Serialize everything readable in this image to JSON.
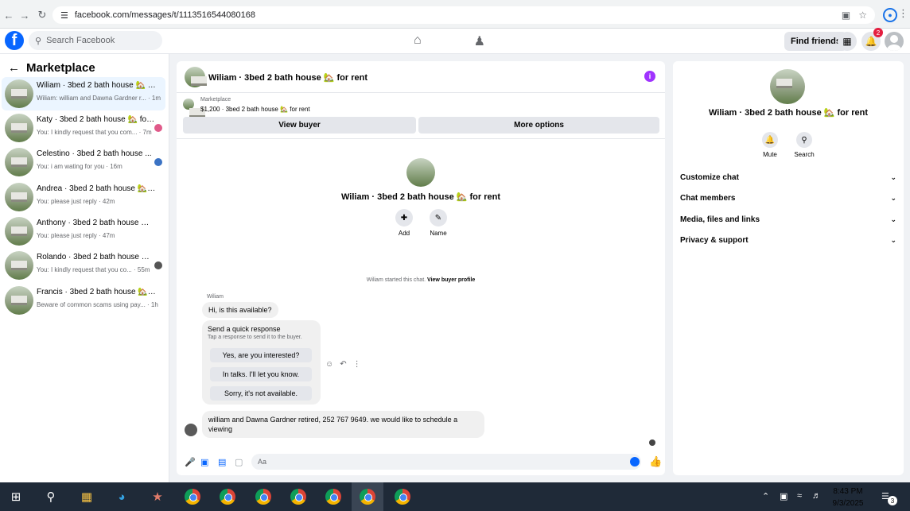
{
  "browser": {
    "url": "facebook.com/messages/t/1113516544080168"
  },
  "topbar": {
    "search_placeholder": "Search Facebook",
    "find_friends": "Find friends",
    "notif_count": "2"
  },
  "sidebar": {
    "title": "Marketplace",
    "conversations": [
      {
        "name": "Wiliam · 3bed 2 bath house 🏡 for...",
        "preview": "Wiliam: william and Dawna Gardner r... · 1m"
      },
      {
        "name": "Katy · 3bed 2 bath house 🏡 for ...",
        "preview": "You: I kindly request that you com... · 7m"
      },
      {
        "name": "Celestino · 3bed 2 bath house ...",
        "preview": "You: i am wating for you · 16m"
      },
      {
        "name": "Andrea · 3bed 2 bath house 🏡 for...",
        "preview": "You: please just reply · 42m"
      },
      {
        "name": "Anthony · 3bed 2 bath house 🏡 f...",
        "preview": "You: please just reply · 47m"
      },
      {
        "name": "Rolando · 3bed 2 bath house 🏡 ...",
        "preview": "You: I kindly request that you co... · 55m"
      },
      {
        "name": "Francis · 3bed 2 bath house 🏡 for...",
        "preview": "Beware of common scams using pay... · 1h"
      }
    ]
  },
  "chat": {
    "title": "Wiliam · 3bed 2 bath house 🏡 for rent",
    "marketplace_label": "Marketplace",
    "listing": "$1,200 · 3bed 2 bath house 🏡 for rent",
    "view_buyer": "View buyer",
    "more_options": "More options",
    "center_title": "Wiliam · 3bed 2 bath house 🏡 for rent",
    "add_label": "Add",
    "name_label": "Name",
    "started_text": "Wiliam started this chat.",
    "view_buyer_profile": "View buyer profile",
    "sender": "Wiliam",
    "msg1": "Hi, is this available?",
    "quick_title": "Send a quick response",
    "quick_sub": "Tap a response to send it to the buyer.",
    "quick_options": [
      "Yes, are you interested?",
      "In talks. I'll let you know.",
      "Sorry, it's not available."
    ],
    "msg2": "william and Dawna Gardner retired, 252 767 9649. we would like to schedule a viewing",
    "composer_placeholder": "Aa"
  },
  "right_panel": {
    "title": "Wiliam · 3bed 2 bath house 🏡 for rent",
    "mute": "Mute",
    "search": "Search",
    "items": [
      "Customize chat",
      "Chat members",
      "Media, files and links",
      "Privacy & support"
    ]
  },
  "taskbar": {
    "time": "8:43 PM",
    "date": "9/3/2025",
    "notif_count": "3"
  }
}
